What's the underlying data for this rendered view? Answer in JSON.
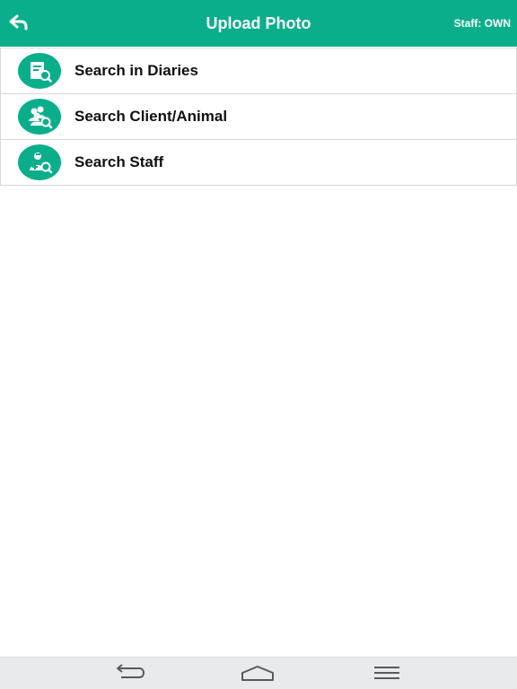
{
  "header": {
    "title": "Upload Photo",
    "staff_label": "Staff: OWN",
    "back_icon": "back-arrow-icon"
  },
  "menu": {
    "items": [
      {
        "label": "Search in Diaries",
        "icon": "diary-search-icon"
      },
      {
        "label": "Search Client/Animal",
        "icon": "client-animal-search-icon"
      },
      {
        "label": "Search Staff",
        "icon": "staff-search-icon"
      }
    ]
  },
  "navbar": {
    "buttons": [
      "back-icon",
      "home-icon",
      "menu-icon"
    ]
  },
  "colors": {
    "accent": "#0aae8b",
    "navbar": "#e8eaeb",
    "border": "#d8d8d8"
  }
}
